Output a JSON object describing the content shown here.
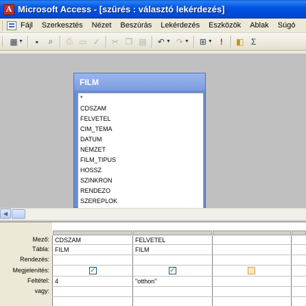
{
  "window": {
    "app_icon_glyph": "A",
    "title": "Microsoft Access - [szűrés : választó lekérdezés]"
  },
  "menu": {
    "items": [
      "Fájl",
      "Szerkesztés",
      "Nézet",
      "Beszúrás",
      "Lekérdezés",
      "Eszközök",
      "Ablak",
      "Súgó"
    ]
  },
  "toolbar": {
    "buttons": [
      "view-icon",
      "save-icon",
      "search-db-icon",
      "print-icon",
      "print-preview-icon",
      "spelling-icon",
      "cut-icon",
      "copy-icon",
      "paste-icon",
      "undo-icon",
      "redo-icon",
      "query-type-icon",
      "run-icon",
      "show-table-icon",
      "totals-icon"
    ]
  },
  "field_list": {
    "title": "FILM",
    "fields": [
      "*",
      "CDSZAM",
      "FELVETEL",
      "CIM_TEMA",
      "DATUM",
      "NEMZET",
      "FILM_TIPUS",
      "HOSSZ",
      "SZINKRON",
      "RENDEZO",
      "SZEREPLOK"
    ]
  },
  "qbe": {
    "row_labels": {
      "field": "Mező:",
      "table": "Tábla:",
      "sort": "Rendezés:",
      "show": "Megjelenítés:",
      "criteria": "Feltétel:",
      "or": "vagy:"
    },
    "columns": [
      {
        "field": "CDSZAM",
        "table": "FILM",
        "sort": "",
        "show": true,
        "criteria": "4",
        "or": ""
      },
      {
        "field": "FELVETEL",
        "table": "FILM",
        "sort": "",
        "show": true,
        "criteria": "\"otthon\"",
        "or": ""
      },
      {
        "field": "",
        "table": "",
        "sort": "",
        "show": false,
        "criteria": "",
        "or": ""
      }
    ]
  }
}
